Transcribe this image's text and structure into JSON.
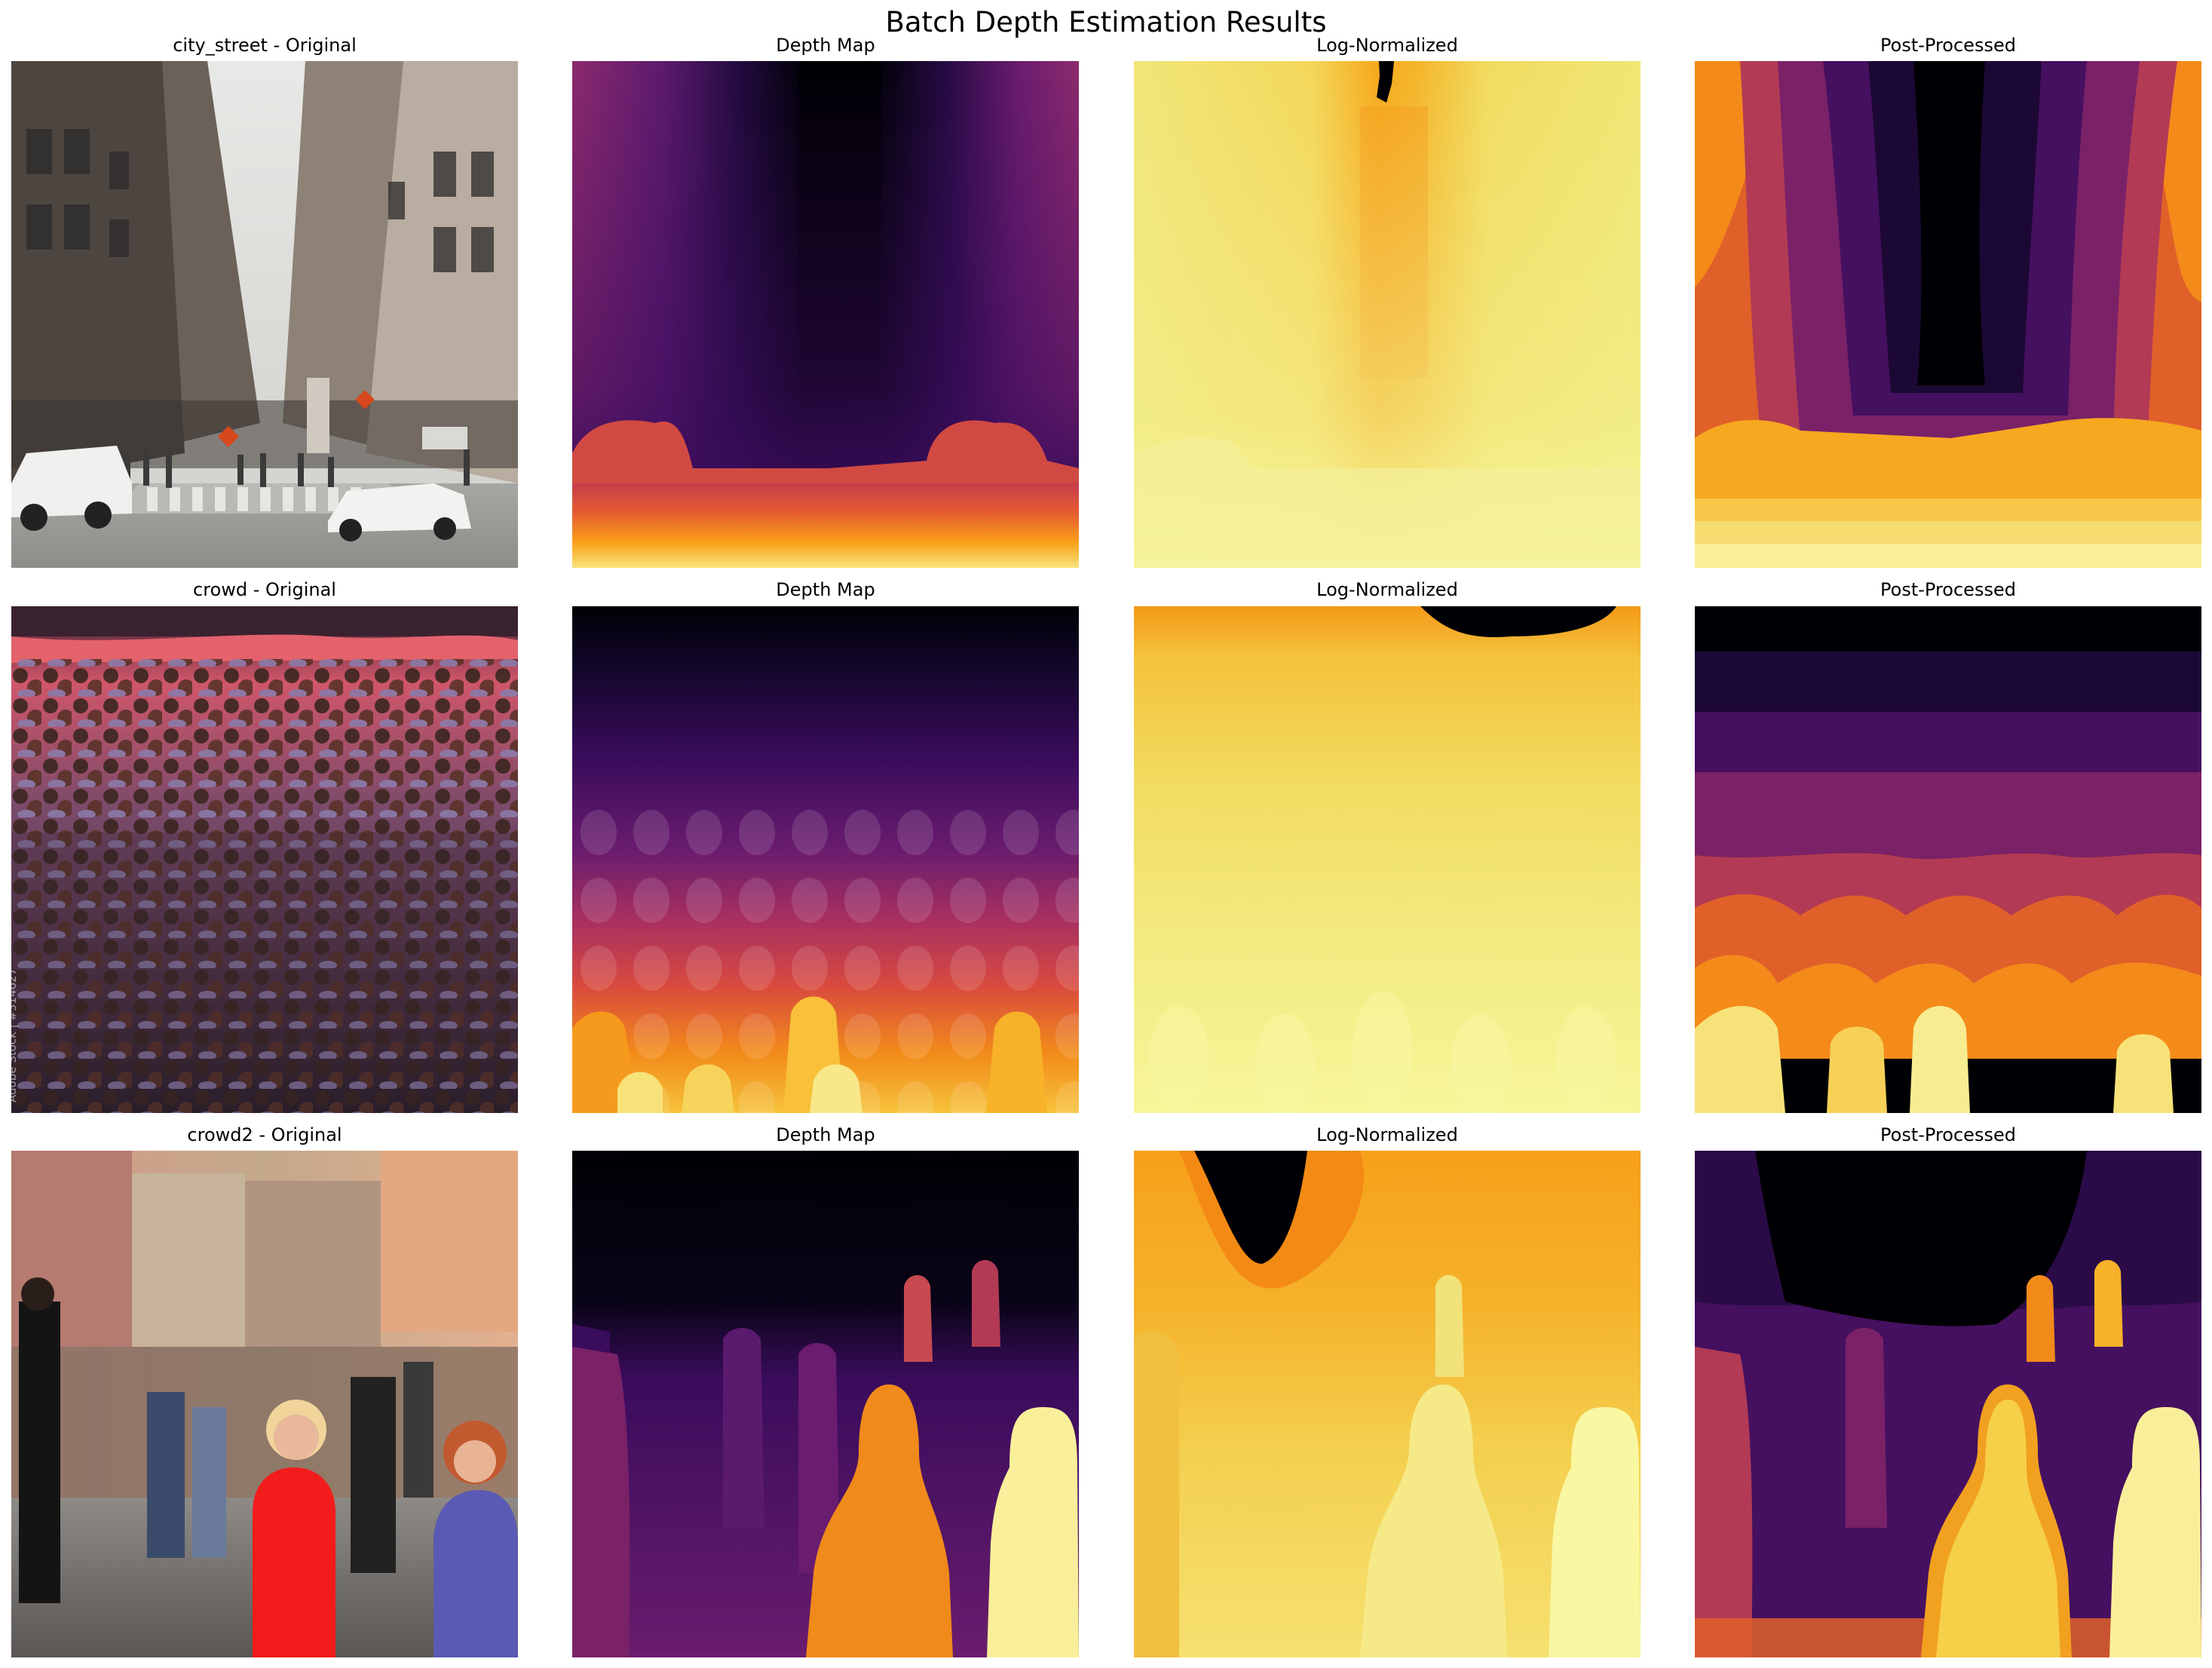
{
  "figure": {
    "title": "Batch Depth Estimation Results"
  },
  "rows": [
    {
      "titles": [
        "city_street - Original",
        "Depth Map",
        "Log-Normalized",
        "Post-Processed"
      ]
    },
    {
      "titles": [
        "crowd - Original",
        "Depth Map",
        "Log-Normalized",
        "Post-Processed"
      ],
      "watermark": "Adobe Stock | #314627"
    },
    {
      "titles": [
        "crowd2 - Original",
        "Depth Map",
        "Log-Normalized",
        "Post-Processed"
      ]
    }
  ],
  "colors": {
    "inferno_dark": "#000004",
    "inferno_purple": "#420a68",
    "inferno_magenta": "#932667",
    "inferno_red": "#dd513a",
    "inferno_orange": "#fca50a",
    "inferno_yellow": "#fcffa4"
  }
}
